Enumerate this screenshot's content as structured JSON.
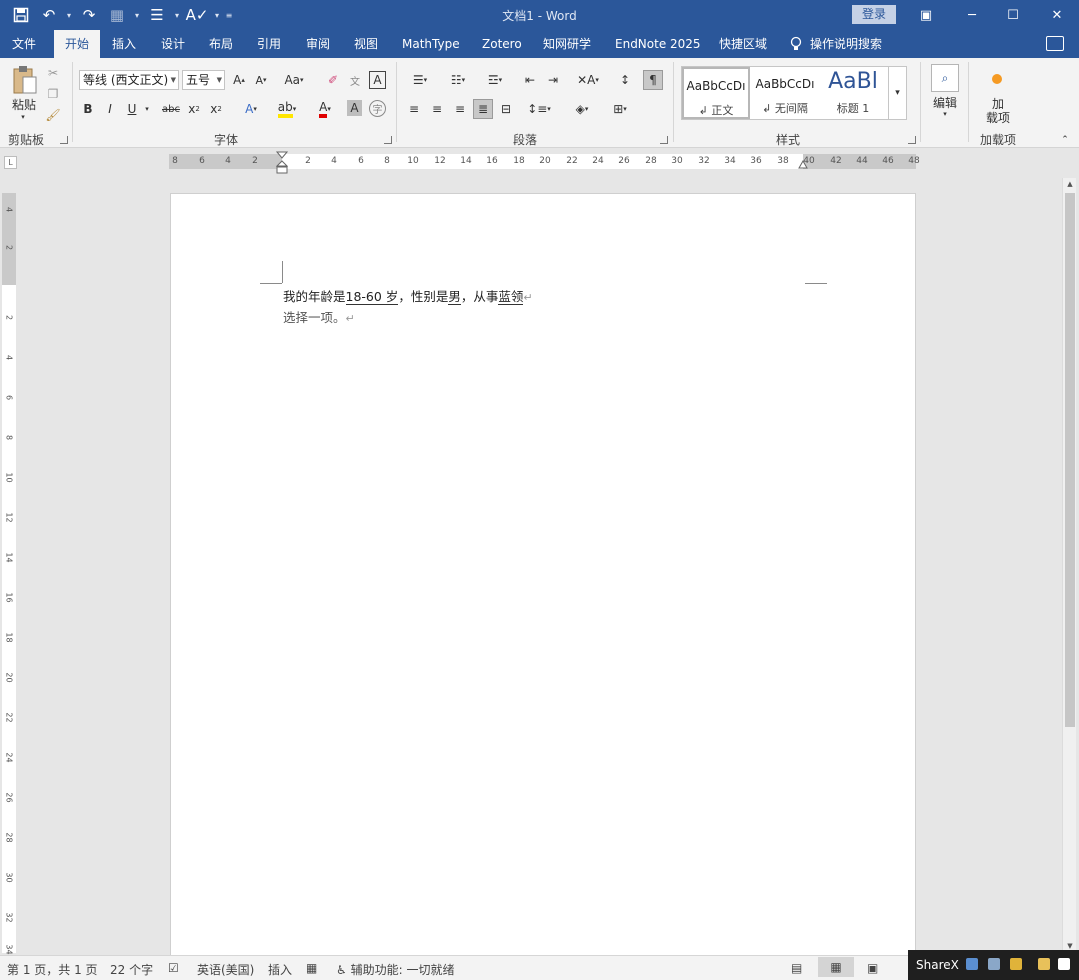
{
  "window": {
    "title": "文档1  -  Word",
    "signin_label": "登录"
  },
  "tabs": [
    "文件",
    "开始",
    "插入",
    "设计",
    "布局",
    "引用",
    "审阅",
    "视图",
    "MathType",
    "Zotero",
    "知网研学",
    "EndNote 2025",
    "快捷区域"
  ],
  "active_tab": "开始",
  "tell_me": "操作说明搜索",
  "ribbon": {
    "clipboard": {
      "paste_label": "粘贴",
      "group_label": "剪贴板"
    },
    "font": {
      "font_name": "等线 (西文正文)",
      "font_size": "五号",
      "group_label": "字体"
    },
    "paragraph": {
      "group_label": "段落"
    },
    "styles": {
      "group_label": "样式",
      "items": [
        {
          "sample": "AaBbCcDı",
          "name": "↲ 正文"
        },
        {
          "sample": "AaBbCcDı",
          "name": "↲ 无间隔"
        },
        {
          "sample": "AaBl",
          "name": "标题 1"
        }
      ]
    },
    "editing": {
      "label": "编辑"
    },
    "addins": {
      "label_line1": "加",
      "label_line2": "载项",
      "group_label": "加载项"
    }
  },
  "ruler": {
    "horizontal_ticks": [
      "8",
      "6",
      "4",
      "2",
      "2",
      "4",
      "6",
      "8",
      "10",
      "12",
      "14",
      "16",
      "18",
      "20",
      "22",
      "24",
      "26",
      "28",
      "30",
      "32",
      "34",
      "36",
      "38",
      "40",
      "42",
      "44",
      "46",
      "48"
    ],
    "vertical_ticks": [
      "4",
      "2",
      "2",
      "4",
      "6",
      "8",
      "10",
      "12",
      "14",
      "16",
      "18",
      "20",
      "22",
      "24",
      "26",
      "28",
      "30",
      "32",
      "34"
    ],
    "corner": "L"
  },
  "document": {
    "line1": {
      "t1": "我的年龄是",
      "age": "18-60 岁",
      "t2": "，性别是",
      "gender": "男",
      "t3": "，从事",
      "job": "蓝领"
    },
    "line2": "选择一项。",
    "paragraph_mark": "↵"
  },
  "status_bar": {
    "page": "第 1 页，共 1 页",
    "words": "22 个字",
    "language": "英语(美国)",
    "mode": "插入",
    "accessibility": "辅助功能: 一切就绪"
  },
  "taskbar": {
    "sharex_label": "ShareX"
  }
}
